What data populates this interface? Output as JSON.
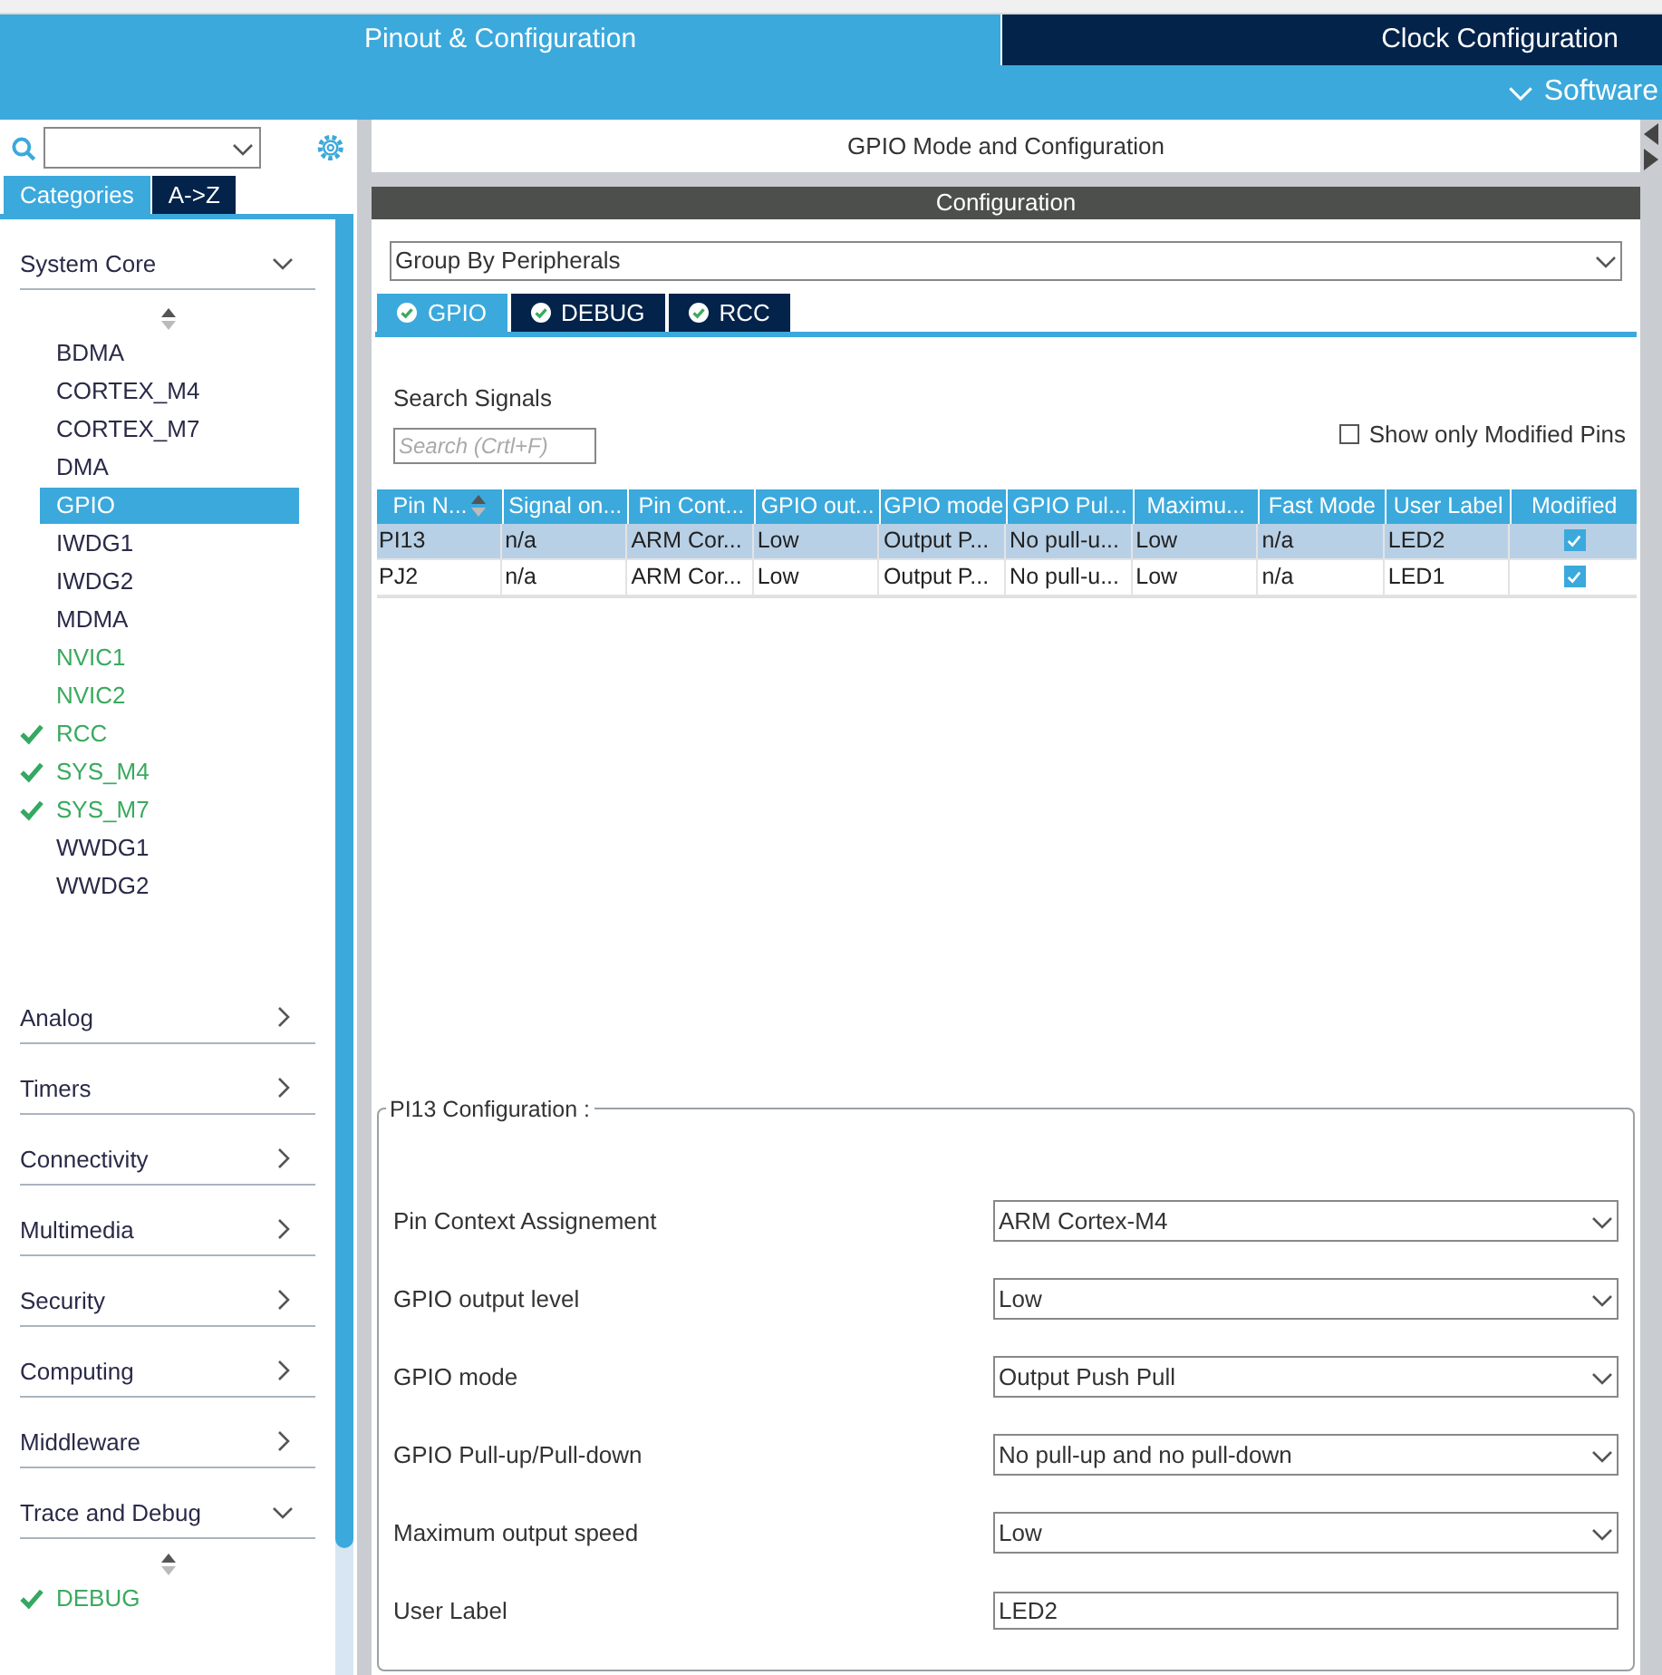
{
  "top_tabs": [
    {
      "label": "Pinout & Configuration",
      "selected": true
    },
    {
      "label": "Clock Configuration",
      "selected": false
    }
  ],
  "software_menu": {
    "label": "Software"
  },
  "sidebar": {
    "tabs": [
      {
        "label": "Categories",
        "selected": true
      },
      {
        "label": "A->Z",
        "selected": false
      }
    ],
    "categories": [
      {
        "label": "System Core",
        "expanded": true,
        "items": [
          {
            "label": "BDMA",
            "active": false,
            "checked": false,
            "selected": false
          },
          {
            "label": "CORTEX_M4",
            "active": false,
            "checked": false,
            "selected": false
          },
          {
            "label": "CORTEX_M7",
            "active": false,
            "checked": false,
            "selected": false
          },
          {
            "label": "DMA",
            "active": false,
            "checked": false,
            "selected": false
          },
          {
            "label": "GPIO",
            "active": false,
            "checked": false,
            "selected": true
          },
          {
            "label": "IWDG1",
            "active": false,
            "checked": false,
            "selected": false
          },
          {
            "label": "IWDG2",
            "active": false,
            "checked": false,
            "selected": false
          },
          {
            "label": "MDMA",
            "active": false,
            "checked": false,
            "selected": false
          },
          {
            "label": "NVIC1",
            "active": true,
            "checked": false,
            "selected": false
          },
          {
            "label": "NVIC2",
            "active": true,
            "checked": false,
            "selected": false
          },
          {
            "label": "RCC",
            "active": true,
            "checked": true,
            "selected": false
          },
          {
            "label": "SYS_M4",
            "active": true,
            "checked": true,
            "selected": false
          },
          {
            "label": "SYS_M7",
            "active": true,
            "checked": true,
            "selected": false
          },
          {
            "label": "WWDG1",
            "active": false,
            "checked": false,
            "selected": false
          },
          {
            "label": "WWDG2",
            "active": false,
            "checked": false,
            "selected": false
          }
        ]
      },
      {
        "label": "Analog",
        "expanded": false
      },
      {
        "label": "Timers",
        "expanded": false
      },
      {
        "label": "Connectivity",
        "expanded": false
      },
      {
        "label": "Multimedia",
        "expanded": false
      },
      {
        "label": "Security",
        "expanded": false
      },
      {
        "label": "Computing",
        "expanded": false
      },
      {
        "label": "Middleware",
        "expanded": false
      },
      {
        "label": "Trace and Debug",
        "expanded": true,
        "items": [
          {
            "label": "DEBUG",
            "active": true,
            "checked": true,
            "selected": false
          }
        ]
      }
    ]
  },
  "main": {
    "title": "GPIO Mode and Configuration",
    "section_title": "Configuration",
    "group_by": {
      "value": "Group By Peripherals"
    },
    "peripheral_tabs": [
      {
        "label": "GPIO",
        "selected": true
      },
      {
        "label": "DEBUG",
        "selected": false
      },
      {
        "label": "RCC",
        "selected": false
      }
    ],
    "search_signals": {
      "label": "Search Signals",
      "placeholder": "Search (Crtl+F)"
    },
    "show_modified": {
      "label": "Show only Modified Pins",
      "checked": false
    },
    "table": {
      "columns": [
        {
          "label": "Pin N...",
          "sorted": true
        },
        {
          "label": "Signal on...",
          "sorted": false
        },
        {
          "label": "Pin Cont...",
          "sorted": false
        },
        {
          "label": "GPIO out...",
          "sorted": false
        },
        {
          "label": "GPIO mode",
          "sorted": false
        },
        {
          "label": "GPIO Pul...",
          "sorted": false
        },
        {
          "label": "Maximu...",
          "sorted": false
        },
        {
          "label": "Fast Mode",
          "sorted": false
        },
        {
          "label": "User Label",
          "sorted": false
        },
        {
          "label": "Modified",
          "sorted": false
        }
      ],
      "rows": [
        {
          "selected": true,
          "cells": [
            "PI13",
            "n/a",
            "ARM Cor...",
            "Low",
            "Output P...",
            "No pull-u...",
            "Low",
            "n/a",
            "LED2"
          ],
          "modified": true
        },
        {
          "selected": false,
          "cells": [
            "PJ2",
            "n/a",
            "ARM Cor...",
            "Low",
            "Output P...",
            "No pull-u...",
            "Low",
            "n/a",
            "LED1"
          ],
          "modified": true
        }
      ]
    },
    "pin_config": {
      "title": "PI13 Configuration :",
      "fields": [
        {
          "label": "Pin Context Assignement",
          "value": "ARM Cortex-M4",
          "kind": "select"
        },
        {
          "label": "GPIO output level",
          "value": "Low",
          "kind": "select"
        },
        {
          "label": "GPIO mode",
          "value": "Output Push Pull",
          "kind": "select"
        },
        {
          "label": "GPIO Pull-up/Pull-down",
          "value": "No pull-up and no pull-down",
          "kind": "select"
        },
        {
          "label": "Maximum output speed",
          "value": "Low",
          "kind": "select"
        },
        {
          "label": "User Label",
          "value": "LED2",
          "kind": "text"
        }
      ]
    }
  }
}
